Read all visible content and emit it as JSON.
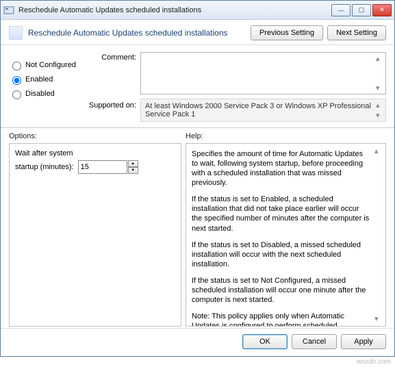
{
  "window": {
    "title": "Reschedule Automatic Updates scheduled installations"
  },
  "header": {
    "title": "Reschedule Automatic Updates scheduled installations",
    "previous": "Previous Setting",
    "next": "Next Setting"
  },
  "state": {
    "not_configured": "Not Configured",
    "enabled": "Enabled",
    "disabled": "Disabled"
  },
  "labels": {
    "comment": "Comment:",
    "supported": "Supported on:",
    "options": "Options:",
    "help": "Help:"
  },
  "supported_text": "At least Windows 2000 Service Pack 3 or Windows XP Professional Service Pack 1",
  "options": {
    "wait_label": "Wait after system",
    "startup_label": "startup (minutes):",
    "value": "15"
  },
  "help": {
    "p1": "Specifies the amount of time for Automatic Updates to wait, following system startup, before proceeding with a scheduled installation that was missed previously.",
    "p2": "If the status is set to Enabled, a scheduled installation that did not take place earlier will occur the specified number of minutes after the computer is next started.",
    "p3": "If the status is set to Disabled, a missed scheduled installation will occur with the next scheduled installation.",
    "p4": "If the status is set to Not Configured, a missed scheduled installation will occur one minute after the computer is next started.",
    "p5": "Note: This policy applies only when Automatic Updates is configured to perform scheduled installations of updates. If the \"Configure Automatic Updates\" policy is disabled, this policy has no effect."
  },
  "footer": {
    "ok": "OK",
    "cancel": "Cancel",
    "apply": "Apply"
  },
  "watermark": "wsxdn.com"
}
